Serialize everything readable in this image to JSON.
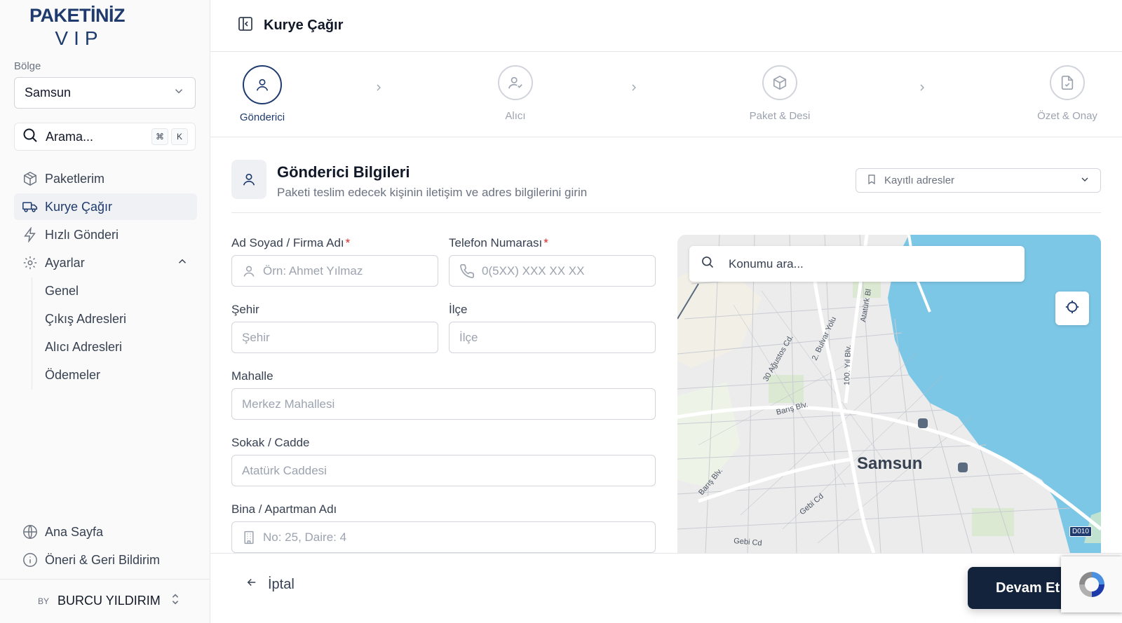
{
  "brand": {
    "line1": "PAKETİNİZ",
    "line2": "VIP"
  },
  "region": {
    "label": "Bölge",
    "value": "Samsun"
  },
  "search": {
    "placeholder": "Arama...",
    "keys": [
      "⌘",
      "K"
    ]
  },
  "nav": {
    "items": [
      {
        "label": "Paketlerim",
        "icon": "box-icon"
      },
      {
        "label": "Kurye Çağır",
        "icon": "truck-icon",
        "active": true
      },
      {
        "label": "Hızlı Gönderi",
        "icon": "lightning-icon"
      },
      {
        "label": "Ayarlar",
        "icon": "gear-icon",
        "expanded": true
      }
    ],
    "settings_sub": [
      "Genel",
      "Çıkış Adresleri",
      "Alıcı Adresleri",
      "Ödemeler"
    ],
    "bottom": [
      {
        "label": "Ana Sayfa",
        "icon": "globe-icon"
      },
      {
        "label": "Öneri & Geri Bildirim",
        "icon": "info-icon"
      }
    ]
  },
  "user": {
    "prefix": "BY",
    "name": "BURCU YILDIRIM"
  },
  "header": {
    "title": "Kurye Çağır"
  },
  "steps": [
    {
      "label": "Gönderici",
      "icon": "user-icon",
      "active": true
    },
    {
      "label": "Alıcı",
      "icon": "user-check-icon"
    },
    {
      "label": "Paket & Desi",
      "icon": "package-icon"
    },
    {
      "label": "Özet & Onay",
      "icon": "file-check-icon"
    }
  ],
  "section": {
    "title": "Gönderici Bilgileri",
    "subtitle": "Paketi teslim edecek kişinin iletişim ve adres bilgilerini girin",
    "saved_addresses": "Kayıtlı adresler"
  },
  "form": {
    "name": {
      "label": "Ad Soyad / Firma Adı",
      "required": "*",
      "placeholder": "Örn: Ahmet Yılmaz"
    },
    "phone": {
      "label": "Telefon Numarası",
      "required": "*",
      "placeholder": "0(5XX) XXX XX XX"
    },
    "city": {
      "label": "Şehir",
      "placeholder": "Şehir"
    },
    "district": {
      "label": "İlçe",
      "placeholder": "İlçe"
    },
    "neighborhood": {
      "label": "Mahalle",
      "placeholder": "Merkez Mahallesi"
    },
    "street": {
      "label": "Sokak / Cadde",
      "placeholder": "Atatürk Caddesi"
    },
    "building": {
      "label": "Bina / Apartman Adı",
      "placeholder": "No: 25, Daire: 4"
    }
  },
  "map": {
    "search_placeholder": "Konumu ara...",
    "city": "Samsun",
    "roads": [
      "30 Ağustos Cd.",
      "2. Bulvar Yolu",
      "100. Yıl Blv.",
      "Atatürk Bl",
      "Barış Blv.",
      "Barış Blv.",
      "Gebi Cd",
      "Gebi Cd"
    ],
    "badge": "D010"
  },
  "footer": {
    "cancel": "İptal",
    "continue": "Devam Et"
  },
  "colors": {
    "primary": "#1f3b6e",
    "dark_button": "#13233c",
    "sea": "#7cc6e6"
  }
}
